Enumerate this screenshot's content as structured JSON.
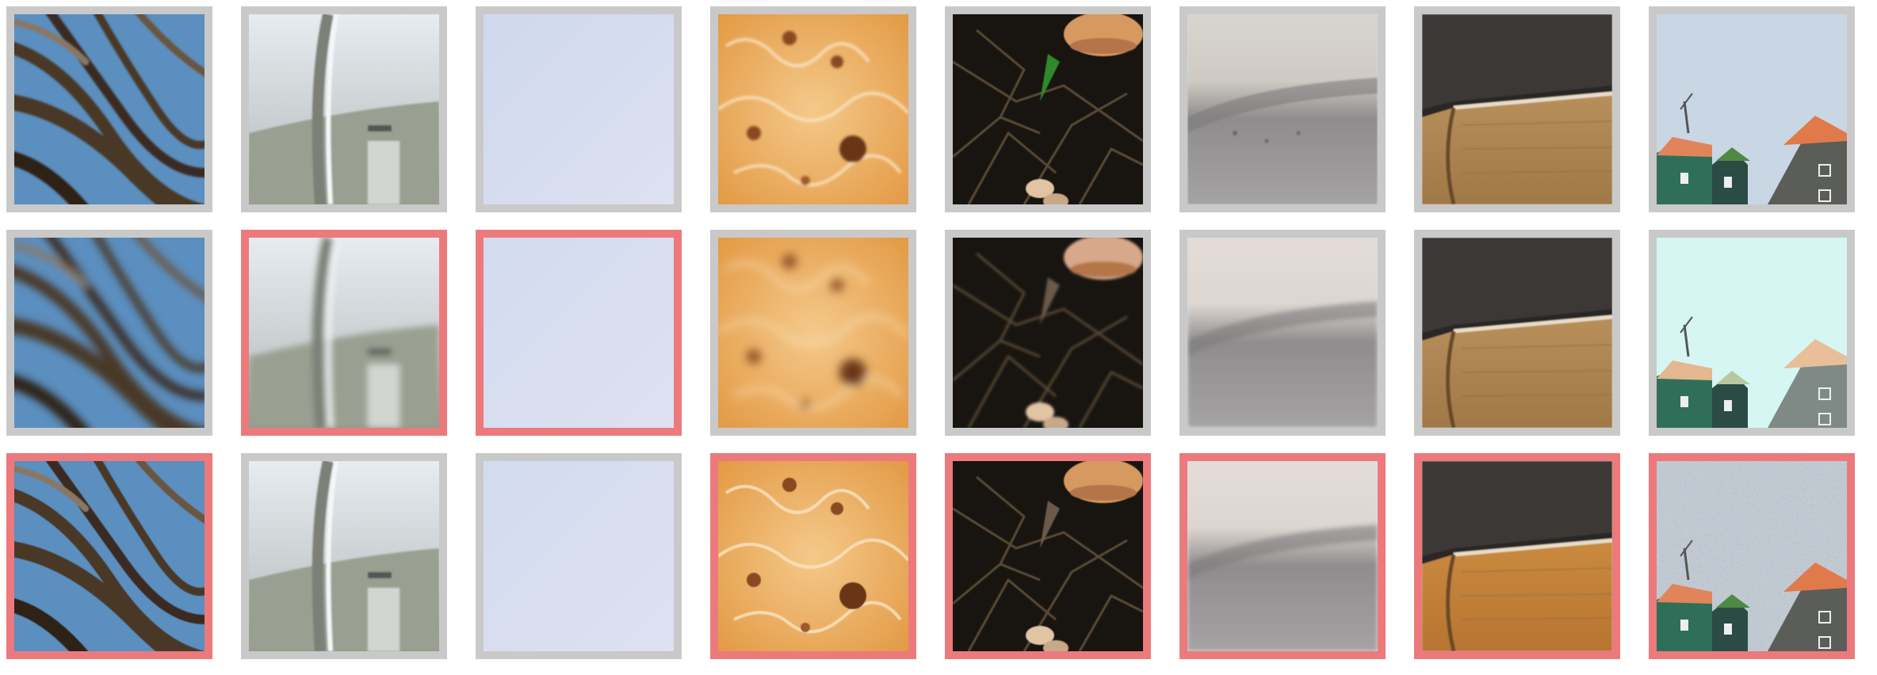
{
  "colors": {
    "border_default": "#c9c9c9",
    "border_highlight": "#ec7a7c",
    "background": "#ffffff"
  },
  "rows": [
    {
      "tiles": [
        {
          "content": "palm-fronds",
          "highlighted": false
        },
        {
          "content": "metal-surface",
          "highlighted": false
        },
        {
          "content": "pale-sky",
          "highlighted": false
        },
        {
          "content": "baked-crust",
          "highlighted": false
        },
        {
          "content": "mushroom-forest-floor",
          "highlighted": false
        },
        {
          "content": "stone-wall",
          "highlighted": false
        },
        {
          "content": "book-spine",
          "highlighted": false
        },
        {
          "content": "windmill-village",
          "highlighted": false
        }
      ]
    },
    {
      "tiles": [
        {
          "content": "palm-fronds",
          "highlighted": false
        },
        {
          "content": "metal-surface",
          "highlighted": true
        },
        {
          "content": "pale-sky",
          "highlighted": true
        },
        {
          "content": "baked-crust",
          "highlighted": false
        },
        {
          "content": "mushroom-forest-floor",
          "highlighted": false
        },
        {
          "content": "stone-wall",
          "highlighted": false
        },
        {
          "content": "book-spine",
          "highlighted": false
        },
        {
          "content": "windmill-village",
          "highlighted": false
        }
      ]
    },
    {
      "tiles": [
        {
          "content": "palm-fronds",
          "highlighted": true
        },
        {
          "content": "metal-surface",
          "highlighted": false
        },
        {
          "content": "pale-sky",
          "highlighted": false
        },
        {
          "content": "baked-crust",
          "highlighted": true
        },
        {
          "content": "mushroom-forest-floor",
          "highlighted": true
        },
        {
          "content": "stone-wall",
          "highlighted": true
        },
        {
          "content": "book-spine",
          "highlighted": true
        },
        {
          "content": "windmill-village",
          "highlighted": true
        }
      ]
    }
  ]
}
